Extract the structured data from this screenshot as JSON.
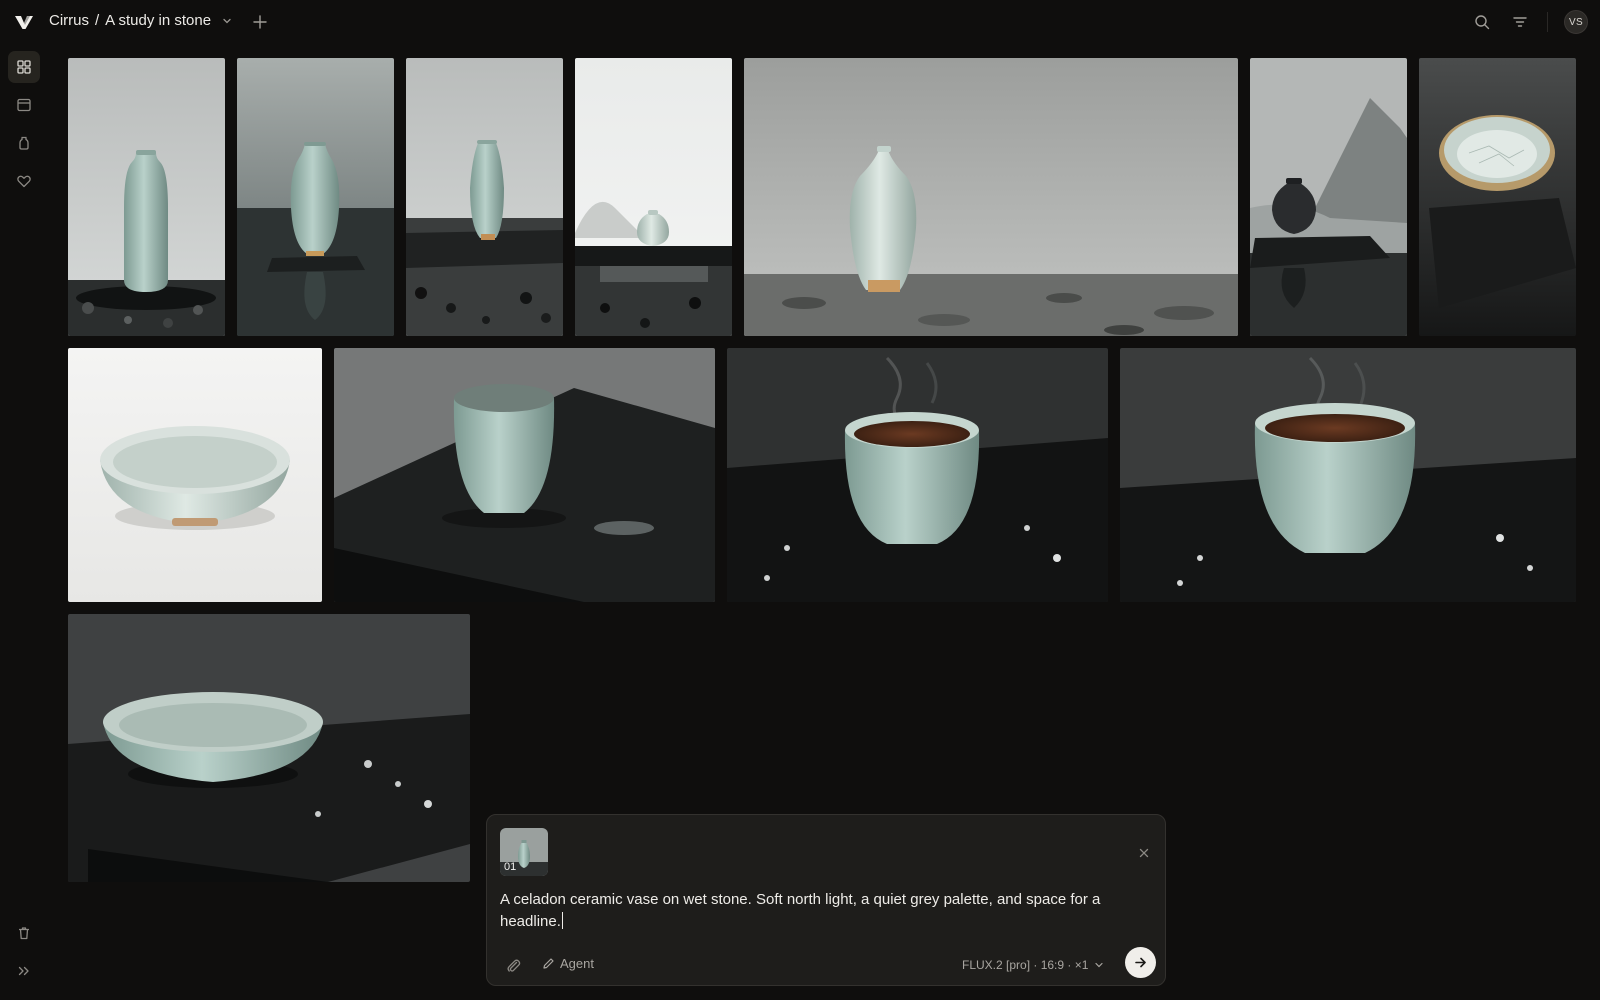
{
  "header": {
    "workspace": "Cirrus",
    "separator": "/",
    "project": "A study in stone",
    "avatar_initials": "VS",
    "icons": [
      "app-logo-icon",
      "chevron-down-icon",
      "plus-icon",
      "search-icon",
      "filter-icon"
    ]
  },
  "sidebar": {
    "items": [
      {
        "name": "grid-view-icon",
        "active": true
      },
      {
        "name": "board-view-icon",
        "active": false
      },
      {
        "name": "jar-icon",
        "active": false
      },
      {
        "name": "heart-icon",
        "active": false
      }
    ],
    "footer": [
      "trash-icon",
      "expand-sidebar-icon"
    ]
  },
  "gallery": {
    "rows": [
      {
        "images": [
          "vase-misty-shore",
          "vase-lake-pedestal",
          "vase-stone-slab",
          "small-vase-foggy-plinth",
          "vase-wet-rocks-wide",
          "dark-vase-mountain",
          "crackle-bowl-slate"
        ]
      },
      {
        "images": [
          "white-bowl-studio",
          "grey-cup-slate",
          "tea-cup-steam",
          "tea-cup-steam-wide"
        ]
      },
      {
        "images": [
          "celadon-bowl-wet-slate"
        ]
      }
    ]
  },
  "composer": {
    "reference_index": "01",
    "prompt_text": "A celadon ceramic vase on wet stone. Soft north light, a quiet grey palette, and space for a headline.",
    "agent_label": "Agent",
    "model_label": "FLUX.2 [pro] · 16:9 · ×1",
    "icons": [
      "close-icon",
      "paperclip-icon",
      "pencil-icon",
      "chevron-down-icon",
      "arrow-right-icon"
    ]
  },
  "colors": {
    "background": "#0f0e0d",
    "composer_bg": "#1e1d1b",
    "celadon": "#a9c3bb",
    "send_button": "#f0eeea"
  }
}
